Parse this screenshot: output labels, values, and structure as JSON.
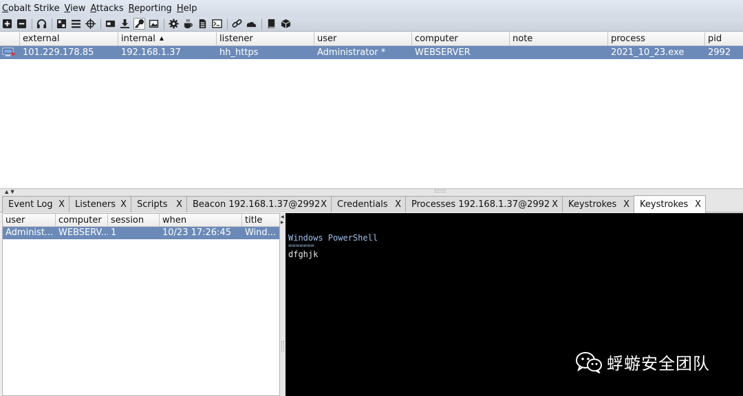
{
  "menu": [
    "Cobalt Strike",
    "View",
    "Attacks",
    "Reporting",
    "Help"
  ],
  "toolbar_icons": [
    "new-connection-icon",
    "disconnect-icon",
    "headphones-icon",
    "pivot-graph-icon",
    "session-list-icon",
    "targets-icon",
    "credentials-icon",
    "downloads-icon",
    "keystrokes-icon",
    "screenshots-icon",
    "settings-icon",
    "java-applet-icon",
    "document-icon",
    "terminal-icon",
    "link-icon",
    "cloud-icon",
    "book-icon",
    "package-icon"
  ],
  "sessions_table": {
    "columns": [
      "",
      "external",
      "internal",
      "listener",
      "user",
      "computer",
      "note",
      "process",
      "pid"
    ],
    "sorted_column": "internal",
    "rows": [
      {
        "external": "101.229.178.85",
        "internal": "192.168.1.37",
        "listener": "hh_https",
        "user": "Administrator *",
        "computer": "WEBSERVER",
        "note": "",
        "process": "2021_10_23.exe",
        "pid": "2992"
      }
    ]
  },
  "tabs": [
    {
      "label": "Event Log",
      "close": "X"
    },
    {
      "label": "Listeners",
      "close": "X"
    },
    {
      "label": "Scripts",
      "close": "X"
    },
    {
      "label": "Beacon 192.168.1.37@2992",
      "close": "X"
    },
    {
      "label": "Credentials",
      "close": "X"
    },
    {
      "label": "Processes 192.168.1.37@2992",
      "close": "X"
    },
    {
      "label": "Keystrokes",
      "close": "X"
    },
    {
      "label": "Keystrokes",
      "close": "X",
      "active": true
    }
  ],
  "keystrokes_table": {
    "columns": [
      "user",
      "computer",
      "session",
      "when",
      "title"
    ],
    "rows": [
      {
        "user": "Administ...",
        "computer": "WEBSERV...",
        "session": "1",
        "when": "10/23 17:26:45",
        "title": "Wind..."
      }
    ]
  },
  "terminal": {
    "title": "Windows PowerShell",
    "underline": "=======",
    "text": "dfghjk"
  },
  "watermark": "蜉蝣安全团队",
  "colors": {
    "selection": "#6b8ab8",
    "terminal_bg": "#000000",
    "terminal_title": "#9fc1ee"
  }
}
